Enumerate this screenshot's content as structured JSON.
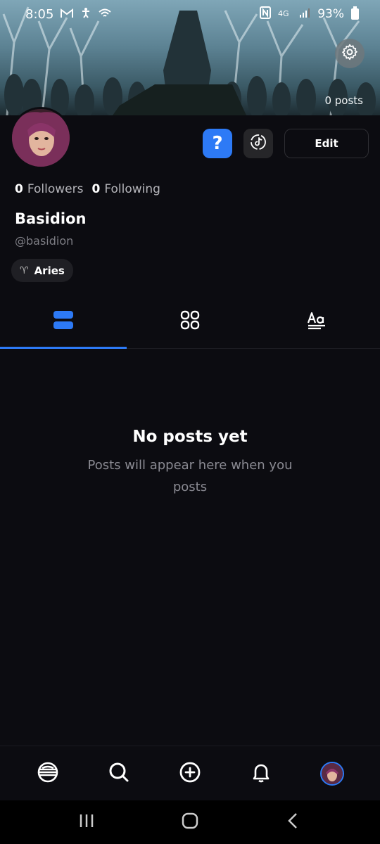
{
  "status_bar": {
    "time": "8:05",
    "battery": "93%",
    "left_icons": [
      "gmail-icon",
      "accessibility-icon",
      "wifi-icon"
    ],
    "right_icons": [
      "nfc-icon",
      "lte-icon",
      "signal-icon",
      "battery-icon"
    ]
  },
  "banner": {
    "post_count": "0 posts",
    "settings_icon": "gear-icon"
  },
  "profile": {
    "followers_count": "0",
    "followers_label": "Followers",
    "following_count": "0",
    "following_label": "Following",
    "display_name": "Basidion",
    "handle": "@basidion",
    "zodiac_symbol": "♈",
    "zodiac": "Aries",
    "help_label": "?",
    "edit_label": "Edit"
  },
  "tabs": [
    {
      "icon": "list-view-icon",
      "active": true
    },
    {
      "icon": "grid-view-icon",
      "active": false
    },
    {
      "icon": "text-posts-icon",
      "active": false
    }
  ],
  "empty_state": {
    "title": "No posts yet",
    "subtitle": "Posts will appear here when you posts"
  },
  "bottom_nav": [
    "home-icon",
    "search-icon",
    "create-icon",
    "notifications-icon",
    "profile-avatar"
  ],
  "colors": {
    "accent": "#2d7af6",
    "background": "#0c0c11"
  }
}
